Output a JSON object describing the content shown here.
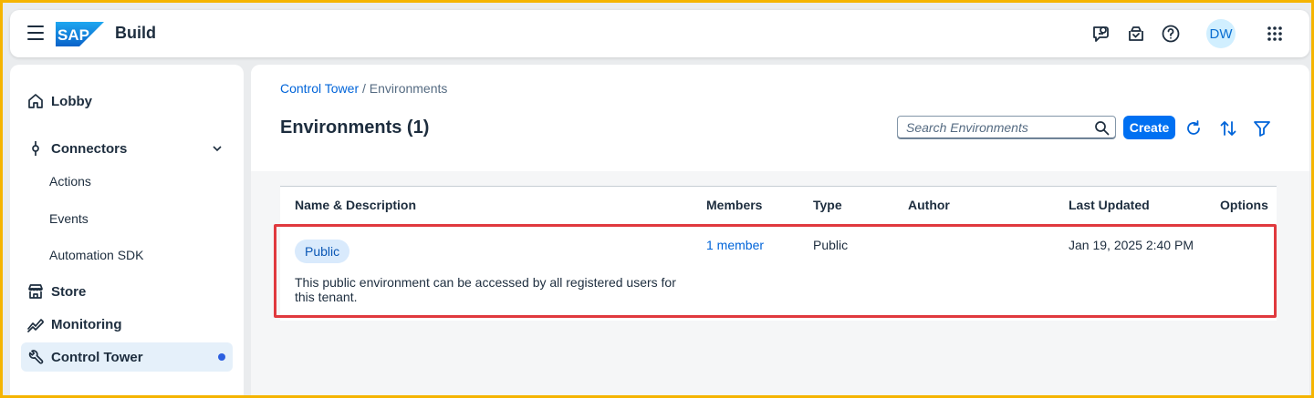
{
  "header": {
    "logo_text": "SAP",
    "product_name": "Build",
    "avatar_initials": "DW",
    "icons": [
      "menu-icon",
      "feedback-icon",
      "notifications-icon",
      "help-icon",
      "app-launcher-icon"
    ]
  },
  "sidebar": {
    "items": [
      {
        "label": "Lobby",
        "icon": "home-icon"
      },
      {
        "label": "Connectors",
        "icon": "connector-icon",
        "expanded": true,
        "children": [
          "Actions",
          "Events",
          "Automation SDK"
        ]
      },
      {
        "label": "Store",
        "icon": "store-icon"
      },
      {
        "label": "Monitoring",
        "icon": "monitoring-icon"
      },
      {
        "label": "Control Tower",
        "icon": "wrench-icon",
        "active": true
      }
    ]
  },
  "main": {
    "breadcrumb": {
      "parent": "Control Tower",
      "separator": " / ",
      "current": "Environments"
    },
    "title": "Environments (1)",
    "search_placeholder": "Search Environments",
    "create_label": "Create",
    "table": {
      "columns": [
        "Name & Description",
        "Members",
        "Type",
        "Author",
        "Last Updated",
        "Options"
      ],
      "rows": [
        {
          "name": "Public",
          "description": "This public environment can be accessed by all registered users for this tenant.",
          "members": "1 member",
          "type": "Public",
          "author": "",
          "last_updated": "Jan 19, 2025 2:40 PM",
          "options": ""
        }
      ]
    }
  },
  "colors": {
    "accent": "#0070f2",
    "link": "#0064d9",
    "highlight_border": "#e0393e",
    "frame_border": "#f5b400",
    "active_nav_bg": "#e5f0fa"
  }
}
